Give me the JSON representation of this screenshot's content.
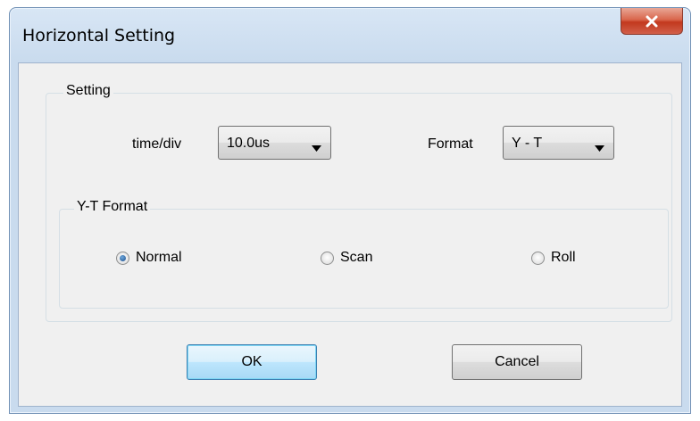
{
  "window": {
    "title": "Horizontal Setting",
    "close_icon": "close-x-icon"
  },
  "setting_group": {
    "legend": "Setting",
    "time_div": {
      "label": "time/div",
      "value": "10.0us"
    },
    "format": {
      "label": "Format",
      "value": "Y - T"
    }
  },
  "yt_group": {
    "legend": "Y-T Format",
    "options": [
      {
        "label": "Normal",
        "checked": true
      },
      {
        "label": "Scan",
        "checked": false
      },
      {
        "label": "Roll",
        "checked": false
      }
    ]
  },
  "buttons": {
    "ok": "OK",
    "cancel": "Cancel"
  },
  "colors": {
    "title_bar": "#c9dbee",
    "close_button": "#c2381e",
    "client_bg": "#f0f0f0",
    "default_button": "#bee6fd"
  }
}
